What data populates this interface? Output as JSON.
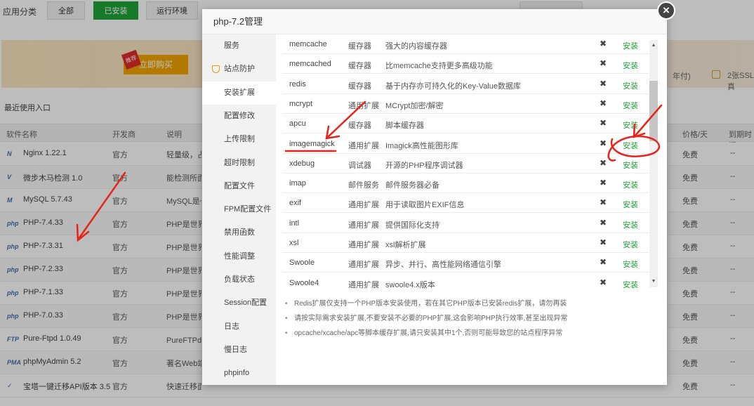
{
  "background": {
    "category_label": "应用分类",
    "categories": [
      {
        "label": "全部",
        "active": false
      },
      {
        "label": "已安装",
        "active": true
      },
      {
        "label": "运行环境",
        "active": false
      }
    ],
    "banner": {
      "recommend_badge": "推荐",
      "buy_button": "立即购买",
      "right_text1": "年付)",
      "right_text2": "2张SSL真"
    },
    "recent_label": "最近使用入口",
    "table": {
      "headers": {
        "name": "软件名称",
        "developer": "开发商",
        "desc": "说明",
        "price": "价格/天",
        "expire": "到期时间"
      },
      "rows": [
        {
          "icon": "N",
          "name": "Nginx 1.22.1",
          "dev": "官方",
          "desc": "轻量级，占有",
          "price": "免费",
          "exp": "--"
        },
        {
          "icon": "V",
          "name": "微步木马检测 1.0",
          "dev": "官方",
          "desc": "能检测所面",
          "price": "免费",
          "exp": "--"
        },
        {
          "icon": "M",
          "name": "MySQL 5.7.43",
          "dev": "官方",
          "desc": "MySQL是一",
          "price": "免费",
          "exp": "--"
        },
        {
          "icon": "php",
          "name": "PHP-7.4.33",
          "dev": "官方",
          "desc": "PHP是世界",
          "price": "免费",
          "exp": "--"
        },
        {
          "icon": "php",
          "name": "PHP-7.3.31",
          "dev": "官方",
          "desc": "PHP是世界",
          "price": "免费",
          "exp": "--"
        },
        {
          "icon": "php",
          "name": "PHP-7.2.33",
          "dev": "官方",
          "desc": "PHP是世界",
          "price": "免费",
          "exp": "--"
        },
        {
          "icon": "php",
          "name": "PHP-7.1.33",
          "dev": "官方",
          "desc": "PHP是世界",
          "price": "免费",
          "exp": "--"
        },
        {
          "icon": "php",
          "name": "PHP-7.0.33",
          "dev": "官方",
          "desc": "PHP是世界",
          "price": "免费",
          "exp": "--"
        },
        {
          "icon": "FTP",
          "name": "Pure-Ftpd 1.0.49",
          "dev": "官方",
          "desc": "PureFTPd是",
          "price": "免费",
          "exp": "--"
        },
        {
          "icon": "PMA",
          "name": "phpMyAdmin 5.2",
          "dev": "官方",
          "desc": "著名Web端",
          "price": "免费",
          "exp": "--"
        },
        {
          "icon": "✓",
          "name": "宝塔一键迁移API版本 3.5",
          "dev": "官方",
          "desc": "快速迁移面板数据",
          "price": "免费",
          "exp": "--"
        }
      ]
    }
  },
  "modal": {
    "title": "php-7.2管理",
    "close_label": "×",
    "sidebar": [
      {
        "label": "服务",
        "active": false
      },
      {
        "label": "站点防护",
        "active": false,
        "icon": "shield-icon"
      },
      {
        "label": "安装扩展",
        "active": true
      },
      {
        "label": "配置修改",
        "active": false
      },
      {
        "label": "上传限制",
        "active": false
      },
      {
        "label": "超时限制",
        "active": false
      },
      {
        "label": "配置文件",
        "active": false
      },
      {
        "label": "FPM配置文件",
        "active": false
      },
      {
        "label": "禁用函数",
        "active": false
      },
      {
        "label": "性能调整",
        "active": false
      },
      {
        "label": "负载状态",
        "active": false
      },
      {
        "label": "Session配置",
        "active": false
      },
      {
        "label": "日志",
        "active": false
      },
      {
        "label": "慢日志",
        "active": false
      },
      {
        "label": "phpinfo",
        "active": false
      }
    ],
    "extensions": [
      {
        "name": "memcache",
        "type": "缓存器",
        "desc": "强大的内容缓存器",
        "action": "安装"
      },
      {
        "name": "memcached",
        "type": "缓存器",
        "desc": "比memcache支持更多高级功能",
        "action": "安装"
      },
      {
        "name": "redis",
        "type": "缓存器",
        "desc": "基于内存亦可持久化的Key-Value数据库",
        "action": "安装"
      },
      {
        "name": "mcrypt",
        "type": "通用扩展",
        "desc": "MCrypt加密/解密",
        "action": "安装"
      },
      {
        "name": "apcu",
        "type": "缓存器",
        "desc": "脚本缓存器",
        "action": "安装"
      },
      {
        "name": "imagemagick",
        "type": "通用扩展",
        "desc": "Imagick高性能图形库",
        "action": "安装"
      },
      {
        "name": "xdebug",
        "type": "调试器",
        "desc": "开源的PHP程序调试器",
        "action": "安装"
      },
      {
        "name": "imap",
        "type": "邮件服务",
        "desc": "邮件服务器必备",
        "action": "安装"
      },
      {
        "name": "exif",
        "type": "通用扩展",
        "desc": "用于读取图片EXIF信息",
        "action": "安装"
      },
      {
        "name": "intl",
        "type": "通用扩展",
        "desc": "提供国际化支持",
        "action": "安装"
      },
      {
        "name": "xsl",
        "type": "通用扩展",
        "desc": "xsl解析扩展",
        "action": "安装"
      },
      {
        "name": "Swoole",
        "type": "通用扩展",
        "desc": "异步、并行、高性能网络通信引擎",
        "action": "安装"
      },
      {
        "name": "Swoole4",
        "type": "通用扩展",
        "desc": "swoole4.x版本",
        "action": "安装"
      }
    ],
    "notes": [
      "Redis扩展仅支持一个PHP版本安装使用，若在其它PHP版本已安装redis扩展，请勿再装",
      "请按实际需求安装扩展,不要安装不必要的PHP扩展,这会影响PHP执行效率,甚至出现异常",
      "opcache/xcache/apc等脚本缓存扩展,请只安装其中1个,否则可能导致您的站点程序异常"
    ]
  },
  "colors": {
    "accent": "#20a53a",
    "annotation": "#e8231a"
  }
}
